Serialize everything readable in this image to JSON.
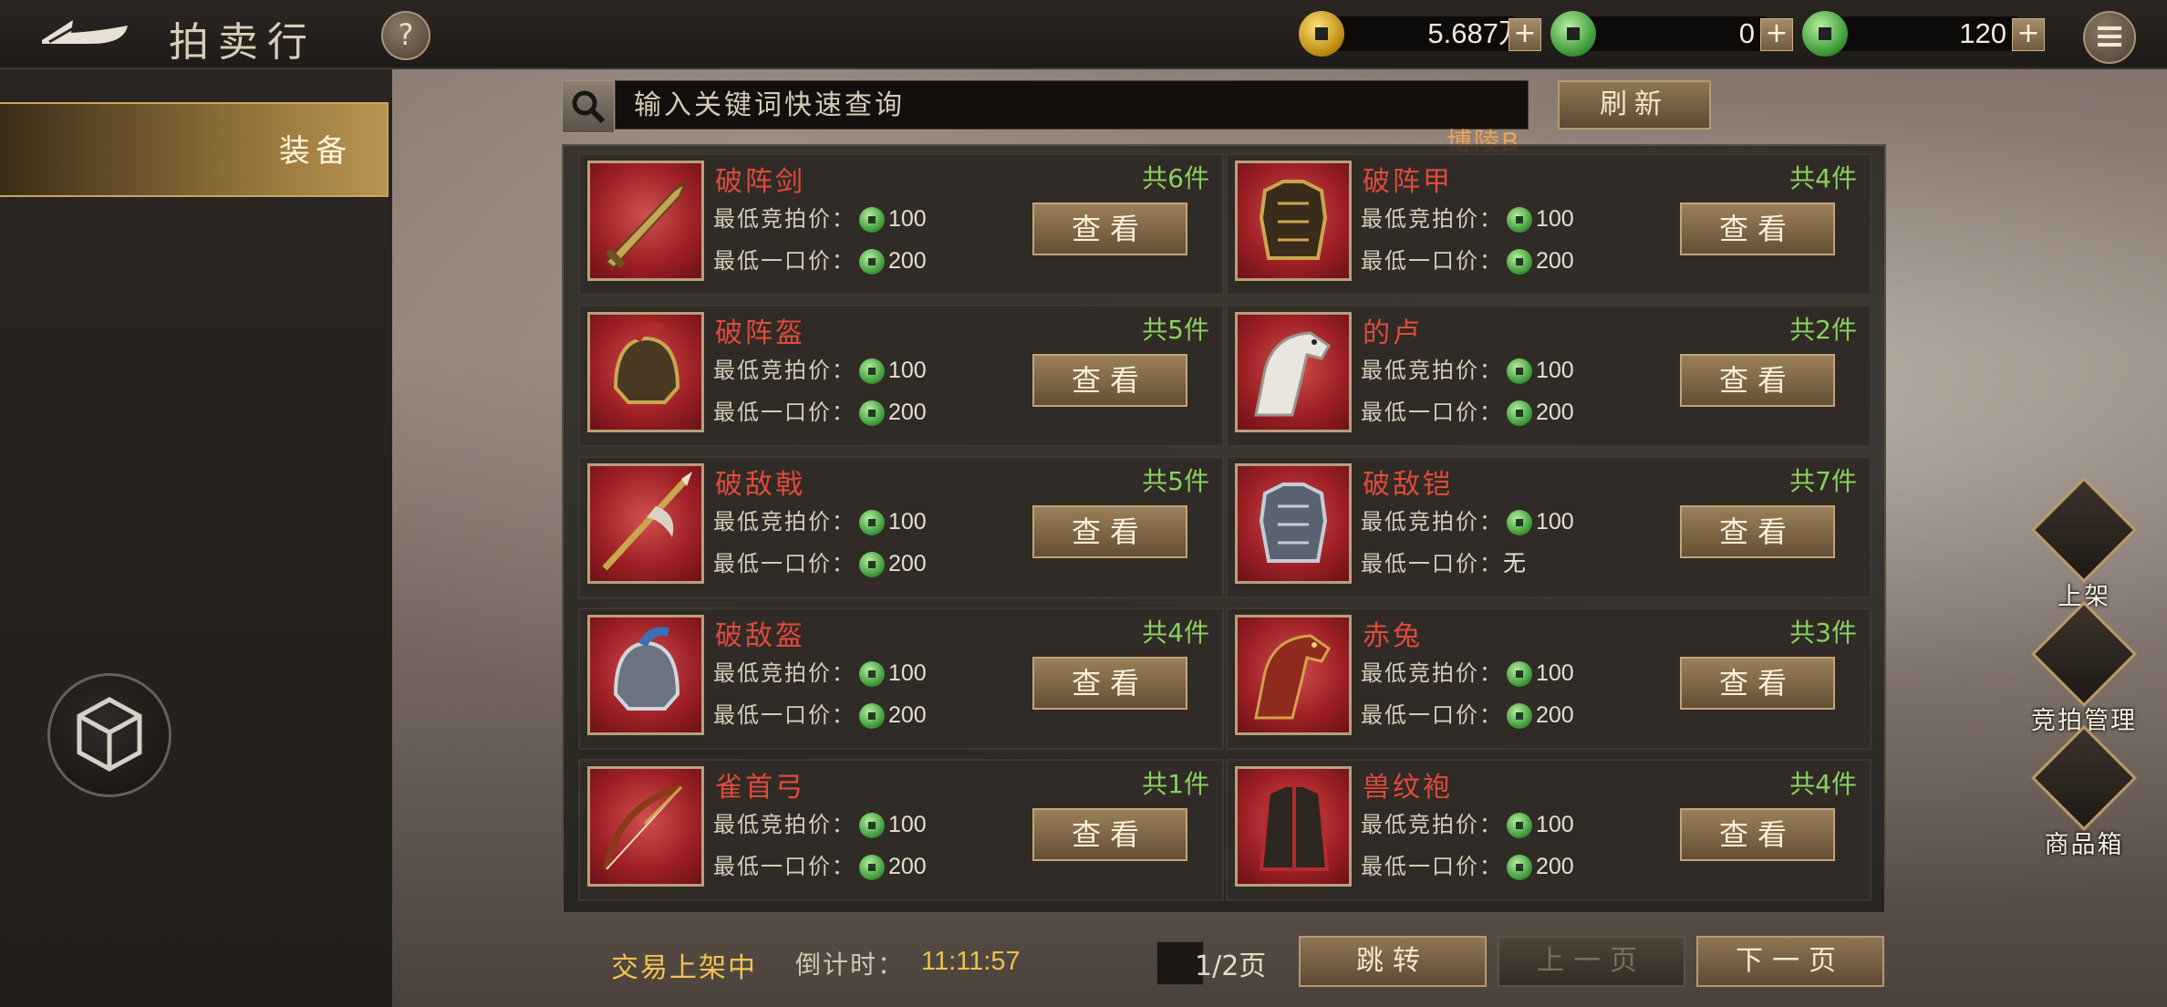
{
  "header": {
    "title": "拍卖行",
    "help_label": "?",
    "resources": [
      {
        "name": "gold-coin",
        "value": "5.687万"
      },
      {
        "name": "jade-ticket",
        "value": "0"
      },
      {
        "name": "jade-coin",
        "value": "120"
      }
    ],
    "plus_label": "+"
  },
  "sidebar": {
    "tabs": [
      {
        "label": "装备"
      }
    ]
  },
  "search": {
    "placeholder": "输入关键词快速查询",
    "refresh_label": "刷新"
  },
  "server_label": "博陵B",
  "listing": {
    "bid_label": "最低竞拍价：",
    "buyout_label": "最低一口价：",
    "view_label": "查看",
    "items": [
      {
        "name": "破阵剑",
        "count": "共6件",
        "bid": "100",
        "buyout": "200",
        "icon": "sword-icon"
      },
      {
        "name": "破阵甲",
        "count": "共4件",
        "bid": "100",
        "buyout": "200",
        "icon": "armor-icon"
      },
      {
        "name": "破阵盔",
        "count": "共5件",
        "bid": "100",
        "buyout": "200",
        "icon": "helmet-icon"
      },
      {
        "name": "的卢",
        "count": "共2件",
        "bid": "100",
        "buyout": "200",
        "icon": "horse-icon"
      },
      {
        "name": "破敌戟",
        "count": "共5件",
        "bid": "100",
        "buyout": "200",
        "icon": "halberd-icon"
      },
      {
        "name": "破敌铠",
        "count": "共7件",
        "bid": "100",
        "buyout": "无",
        "icon": "armor-icon"
      },
      {
        "name": "破敌盔",
        "count": "共4件",
        "bid": "100",
        "buyout": "200",
        "icon": "helmet-icon"
      },
      {
        "name": "赤兔",
        "count": "共3件",
        "bid": "100",
        "buyout": "200",
        "icon": "horse-icon"
      },
      {
        "name": "雀首弓",
        "count": "共1件",
        "bid": "100",
        "buyout": "200",
        "icon": "bow-icon"
      },
      {
        "name": "兽纹袍",
        "count": "共4件",
        "bid": "100",
        "buyout": "200",
        "icon": "robe-icon"
      }
    ]
  },
  "footer": {
    "status": "交易上架中",
    "countdown_label": "倒计时：",
    "countdown": "11:11:57",
    "page": "1/2页",
    "jump_label": "跳转",
    "prev_label": "上一页",
    "next_label": "下一页"
  },
  "side_actions": [
    {
      "label": "上架",
      "icon": "shelf-icon"
    },
    {
      "label": "竞拍管理",
      "icon": "hammer-icon"
    },
    {
      "label": "商品箱",
      "icon": "chest-icon"
    }
  ],
  "colors": {
    "item_name": "#e04a3c",
    "count": "#8ad15e",
    "status": "#f3c34f",
    "server": "#e9a35c"
  }
}
